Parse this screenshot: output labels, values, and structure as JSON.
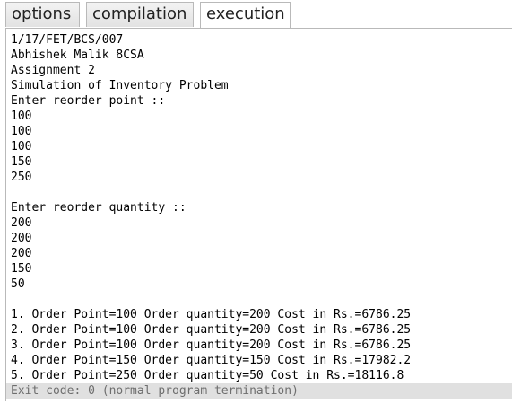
{
  "tabs": [
    {
      "label": "options",
      "active": false
    },
    {
      "label": "compilation",
      "active": false
    },
    {
      "label": "execution",
      "active": true
    }
  ],
  "output": {
    "lines": [
      "1/17/FET/BCS/007",
      "Abhishek Malik 8CSA",
      "Assignment 2",
      "Simulation of Inventory Problem",
      "Enter reorder point ::",
      "100",
      "100",
      "100",
      "150",
      "250",
      "",
      "Enter reorder quantity ::",
      "200",
      "200",
      "200",
      "150",
      "50",
      "",
      "1. Order Point=100 Order quantity=200 Cost in Rs.=6786.25",
      "2. Order Point=100 Order quantity=200 Cost in Rs.=6786.25",
      "3. Order Point=100 Order quantity=200 Cost in Rs.=6786.25",
      "4. Order Point=150 Order quantity=150 Cost in Rs.=17982.2",
      "5. Order Point=250 Order quantity=50 Cost in Rs.=18116.8"
    ],
    "exit_message": "Exit code: 0 (normal program termination)"
  }
}
